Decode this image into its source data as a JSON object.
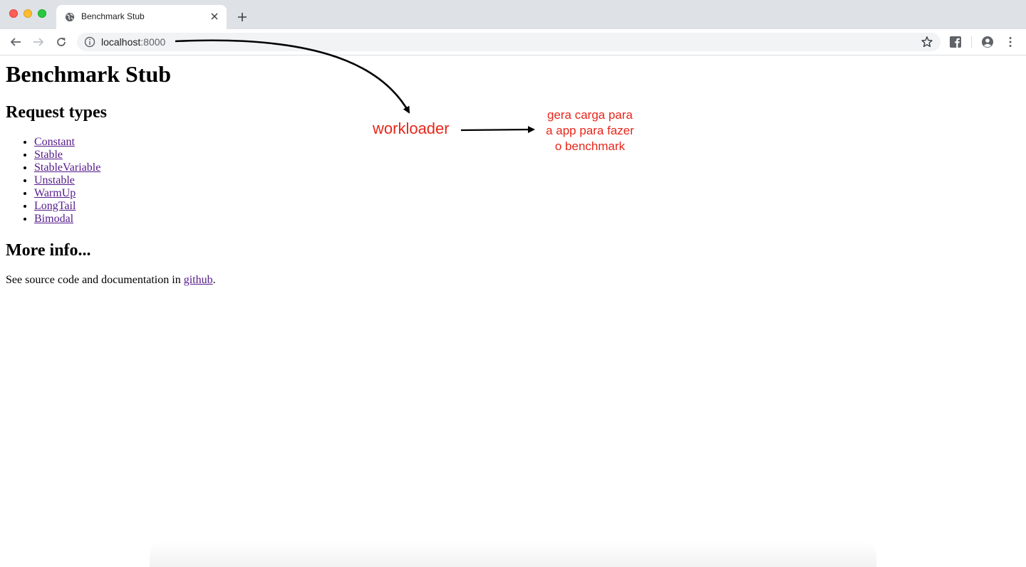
{
  "browser": {
    "tab_title": "Benchmark Stub",
    "url_host": "localhost",
    "url_port": ":8000"
  },
  "page": {
    "title": "Benchmark Stub",
    "request_types_heading": "Request types",
    "request_types": [
      "Constant",
      "Stable",
      "StableVariable",
      "Unstable",
      "WarmUp",
      "LongTail",
      "Bimodal"
    ],
    "more_info_heading": "More info...",
    "info_text_before": "See source code and documentation in ",
    "info_link": "github",
    "info_text_after": "."
  },
  "annotations": {
    "workloader_label": "workloader",
    "description_lines": [
      "gera carga para",
      "a app para fazer",
      "o benchmark"
    ],
    "annotation_color": "#e8261a"
  },
  "colors": {
    "chrome_bg": "#dee1e6",
    "link_visited": "#551a8b"
  }
}
